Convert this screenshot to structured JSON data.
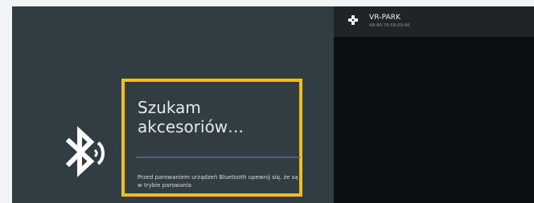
{
  "screen": {
    "title_line1": "Szukam",
    "title_line2": "akcesoriów…",
    "hint": "Przed parowaniem urządzeń Bluetooth upewnij się, że są w trybie parowania"
  },
  "devices": [
    {
      "name": "VR-PARK",
      "address": "A8:90:78:58:09:66",
      "icon": "gamepad-icon"
    }
  ],
  "icons": {
    "bluetooth": "bluetooth-searching-icon"
  },
  "colors": {
    "highlight": "#f4bd1b",
    "panel": "#313d43",
    "right_panel": "#0c0f11"
  }
}
